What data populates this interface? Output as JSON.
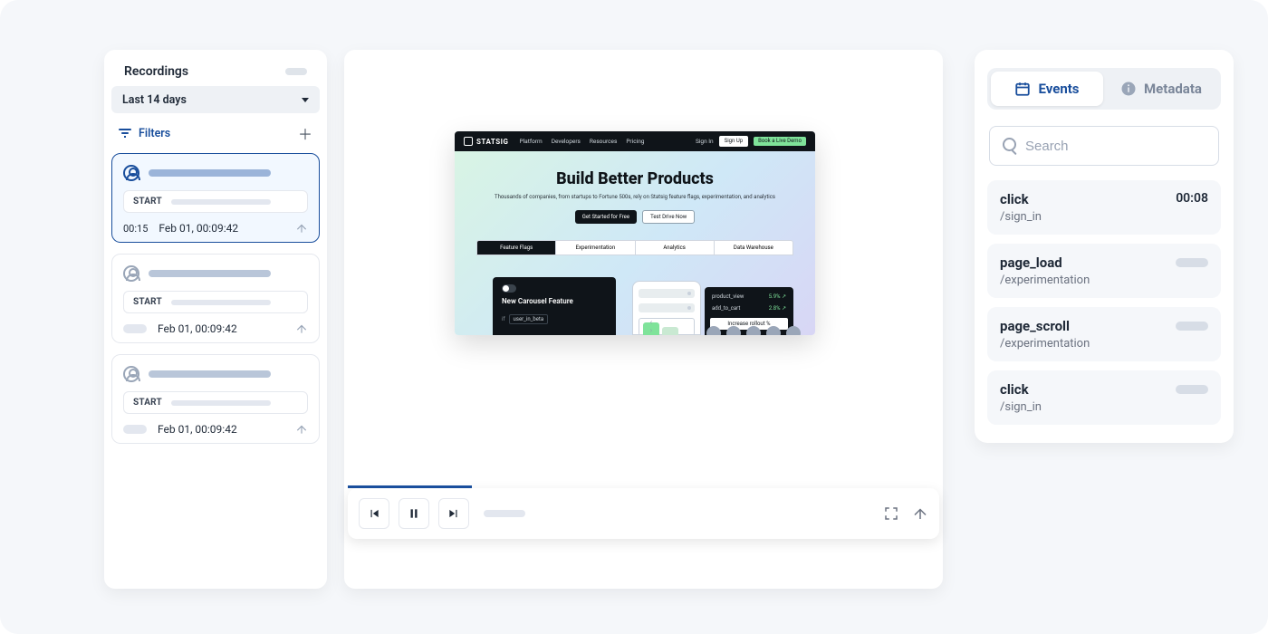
{
  "left": {
    "title": "Recordings",
    "range": "Last 14 days",
    "filters_label": "Filters",
    "cards": [
      {
        "selected": true,
        "start_label": "START",
        "duration": "00:15",
        "timestamp": "Feb 01, 00:09:42"
      },
      {
        "selected": false,
        "start_label": "START",
        "timestamp": "Feb 01, 00:09:42"
      },
      {
        "selected": false,
        "start_label": "START",
        "timestamp": "Feb 01, 00:09:42"
      }
    ]
  },
  "preview": {
    "brand": "STATSIG",
    "nav": [
      "Platform",
      "Developers",
      "Resources",
      "Pricing"
    ],
    "sign_in": "Sign In",
    "sign_up": "Sign Up",
    "demo": "Book a Live Demo",
    "hero_title": "Build Better Products",
    "hero_sub": "Thousands of companies, from startups to Fortune 500s, rely on Statsig feature flags, experimentation, and analytics",
    "cta_primary": "Get Started for Free",
    "cta_secondary": "Test Drive Now",
    "tabs": [
      "Feature Flags",
      "Experimentation",
      "Analytics",
      "Data Warehouse"
    ],
    "card_title": "New Carousel Feature",
    "card_if": "if",
    "card_cond": "user_in_beta",
    "stats": [
      {
        "k": "product_view",
        "v": "5.9%"
      },
      {
        "k": "add_to_cart",
        "v": "2.8%"
      }
    ],
    "rollout_btn": "Increase rollout %"
  },
  "right": {
    "tab_events": "Events",
    "tab_metadata": "Metadata",
    "search_placeholder": "Search",
    "events": [
      {
        "name": "click",
        "path": "/sign_in",
        "time": "00:08"
      },
      {
        "name": "page_load",
        "path": "/experimentation",
        "time": null
      },
      {
        "name": "page_scroll",
        "path": "/experimentation",
        "time": null
      },
      {
        "name": "click",
        "path": "/sign_in",
        "time": null
      }
    ]
  }
}
